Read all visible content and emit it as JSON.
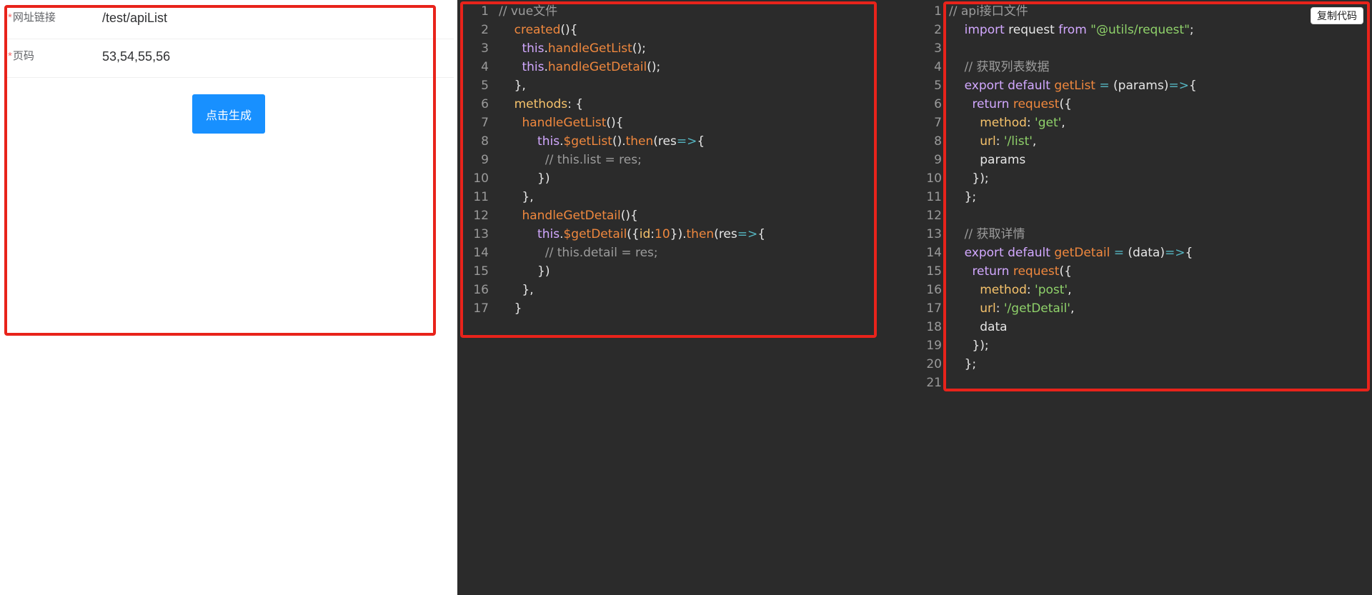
{
  "form": {
    "rows": [
      {
        "label": "网址链接",
        "required_mark": "*",
        "value": "/test/apiList"
      },
      {
        "label": "页码",
        "required_mark": "*",
        "value": "53,54,55,56"
      }
    ],
    "generate_button": "点击生成"
  },
  "code_panels": {
    "vue": {
      "lines": [
        [
          {
            "t": "// vue文件",
            "c": "#9c9c9c"
          }
        ],
        [
          {
            "t": "    "
          },
          {
            "t": "created",
            "c": "#f0883e"
          },
          {
            "t": "(){",
            "c": "#e6e6e6"
          }
        ],
        [
          {
            "t": "      "
          },
          {
            "t": "this",
            "c": "#d2a8ff"
          },
          {
            "t": ".",
            "c": "#e6e6e6"
          },
          {
            "t": "handleGetList",
            "c": "#f0883e"
          },
          {
            "t": "();",
            "c": "#e6e6e6"
          }
        ],
        [
          {
            "t": "      "
          },
          {
            "t": "this",
            "c": "#d2a8ff"
          },
          {
            "t": ".",
            "c": "#e6e6e6"
          },
          {
            "t": "handleGetDetail",
            "c": "#f0883e"
          },
          {
            "t": "();",
            "c": "#e6e6e6"
          }
        ],
        [
          {
            "t": "    },",
            "c": "#e6e6e6"
          }
        ],
        [
          {
            "t": "    "
          },
          {
            "t": "methods",
            "c": "#f5c26b"
          },
          {
            "t": ": {",
            "c": "#e6e6e6"
          }
        ],
        [
          {
            "t": "      "
          },
          {
            "t": "handleGetList",
            "c": "#f0883e"
          },
          {
            "t": "(){",
            "c": "#e6e6e6"
          }
        ],
        [
          {
            "t": "          "
          },
          {
            "t": "this",
            "c": "#d2a8ff"
          },
          {
            "t": ".",
            "c": "#e6e6e6"
          },
          {
            "t": "$getList",
            "c": "#f0883e"
          },
          {
            "t": "().",
            "c": "#e6e6e6"
          },
          {
            "t": "then",
            "c": "#f0883e"
          },
          {
            "t": "(res",
            "c": "#e6e6e6"
          },
          {
            "t": "=>",
            "c": "#56b6c2"
          },
          {
            "t": "{",
            "c": "#e6e6e6"
          }
        ],
        [
          {
            "t": "            "
          },
          {
            "t": "// this.list = res;",
            "c": "#9c9c9c"
          }
        ],
        [
          {
            "t": "          })",
            "c": "#e6e6e6"
          }
        ],
        [
          {
            "t": "      },",
            "c": "#e6e6e6"
          }
        ],
        [
          {
            "t": "      "
          },
          {
            "t": "handleGetDetail",
            "c": "#f0883e"
          },
          {
            "t": "(){",
            "c": "#e6e6e6"
          }
        ],
        [
          {
            "t": "          "
          },
          {
            "t": "this",
            "c": "#d2a8ff"
          },
          {
            "t": ".",
            "c": "#e6e6e6"
          },
          {
            "t": "$getDetail",
            "c": "#f0883e"
          },
          {
            "t": "({",
            "c": "#e6e6e6"
          },
          {
            "t": "id",
            "c": "#f5c26b"
          },
          {
            "t": ":",
            "c": "#e6e6e6"
          },
          {
            "t": "10",
            "c": "#f0883e"
          },
          {
            "t": "}).",
            "c": "#e6e6e6"
          },
          {
            "t": "then",
            "c": "#f0883e"
          },
          {
            "t": "(res",
            "c": "#e6e6e6"
          },
          {
            "t": "=>",
            "c": "#56b6c2"
          },
          {
            "t": "{",
            "c": "#e6e6e6"
          }
        ],
        [
          {
            "t": "            "
          },
          {
            "t": "// this.detail = res;",
            "c": "#9c9c9c"
          }
        ],
        [
          {
            "t": "          })",
            "c": "#e6e6e6"
          }
        ],
        [
          {
            "t": "      },",
            "c": "#e6e6e6"
          }
        ],
        [
          {
            "t": "    }",
            "c": "#e6e6e6"
          }
        ]
      ]
    },
    "api": {
      "copy_button": "复制代码",
      "lines": [
        [
          {
            "t": "// api接口文件",
            "c": "#9c9c9c"
          }
        ],
        [
          {
            "t": "    "
          },
          {
            "t": "import",
            "c": "#d2a8ff"
          },
          {
            "t": " request ",
            "c": "#e6e6e6"
          },
          {
            "t": "from",
            "c": "#d2a8ff"
          },
          {
            "t": " ",
            "c": "#e6e6e6"
          },
          {
            "t": "\"@utils/request\"",
            "c": "#8fd16a"
          },
          {
            "t": ";",
            "c": "#e6e6e6"
          }
        ],
        [
          {
            "t": ""
          }
        ],
        [
          {
            "t": "    "
          },
          {
            "t": "// 获取列表数据",
            "c": "#9c9c9c"
          }
        ],
        [
          {
            "t": "    "
          },
          {
            "t": "export",
            "c": "#d2a8ff"
          },
          {
            "t": " ",
            "c": "#e6e6e6"
          },
          {
            "t": "default",
            "c": "#d2a8ff"
          },
          {
            "t": " ",
            "c": "#e6e6e6"
          },
          {
            "t": "getList",
            "c": "#f0883e"
          },
          {
            "t": " ",
            "c": "#e6e6e6"
          },
          {
            "t": "=",
            "c": "#56b6c2"
          },
          {
            "t": " (params)",
            "c": "#e6e6e6"
          },
          {
            "t": "=>",
            "c": "#56b6c2"
          },
          {
            "t": "{",
            "c": "#e6e6e6"
          }
        ],
        [
          {
            "t": "      "
          },
          {
            "t": "return",
            "c": "#d2a8ff"
          },
          {
            "t": " ",
            "c": "#e6e6e6"
          },
          {
            "t": "request",
            "c": "#f0883e"
          },
          {
            "t": "({",
            "c": "#e6e6e6"
          }
        ],
        [
          {
            "t": "        "
          },
          {
            "t": "method",
            "c": "#f5c26b"
          },
          {
            "t": ": ",
            "c": "#e6e6e6"
          },
          {
            "t": "'get'",
            "c": "#8fd16a"
          },
          {
            "t": ",",
            "c": "#e6e6e6"
          }
        ],
        [
          {
            "t": "        "
          },
          {
            "t": "url",
            "c": "#f5c26b"
          },
          {
            "t": ": ",
            "c": "#e6e6e6"
          },
          {
            "t": "'/list'",
            "c": "#8fd16a"
          },
          {
            "t": ",",
            "c": "#e6e6e6"
          }
        ],
        [
          {
            "t": "        params",
            "c": "#e6e6e6"
          }
        ],
        [
          {
            "t": "      });",
            "c": "#e6e6e6"
          }
        ],
        [
          {
            "t": "    };",
            "c": "#e6e6e6"
          }
        ],
        [
          {
            "t": ""
          }
        ],
        [
          {
            "t": "    "
          },
          {
            "t": "// 获取详情",
            "c": "#9c9c9c"
          }
        ],
        [
          {
            "t": "    "
          },
          {
            "t": "export",
            "c": "#d2a8ff"
          },
          {
            "t": " ",
            "c": "#e6e6e6"
          },
          {
            "t": "default",
            "c": "#d2a8ff"
          },
          {
            "t": " ",
            "c": "#e6e6e6"
          },
          {
            "t": "getDetail",
            "c": "#f0883e"
          },
          {
            "t": " ",
            "c": "#e6e6e6"
          },
          {
            "t": "=",
            "c": "#56b6c2"
          },
          {
            "t": " (data)",
            "c": "#e6e6e6"
          },
          {
            "t": "=>",
            "c": "#56b6c2"
          },
          {
            "t": "{",
            "c": "#e6e6e6"
          }
        ],
        [
          {
            "t": "      "
          },
          {
            "t": "return",
            "c": "#d2a8ff"
          },
          {
            "t": " ",
            "c": "#e6e6e6"
          },
          {
            "t": "request",
            "c": "#f0883e"
          },
          {
            "t": "({",
            "c": "#e6e6e6"
          }
        ],
        [
          {
            "t": "        "
          },
          {
            "t": "method",
            "c": "#f5c26b"
          },
          {
            "t": ": ",
            "c": "#e6e6e6"
          },
          {
            "t": "'post'",
            "c": "#8fd16a"
          },
          {
            "t": ",",
            "c": "#e6e6e6"
          }
        ],
        [
          {
            "t": "        "
          },
          {
            "t": "url",
            "c": "#f5c26b"
          },
          {
            "t": ": ",
            "c": "#e6e6e6"
          },
          {
            "t": "'/getDetail'",
            "c": "#8fd16a"
          },
          {
            "t": ",",
            "c": "#e6e6e6"
          }
        ],
        [
          {
            "t": "        data",
            "c": "#e6e6e6"
          }
        ],
        [
          {
            "t": "      });",
            "c": "#e6e6e6"
          }
        ],
        [
          {
            "t": "    };",
            "c": "#e6e6e6"
          }
        ],
        [
          {
            "t": ""
          }
        ]
      ]
    }
  },
  "colors": {
    "highlight_border": "#e8231b",
    "primary_button": "#1890ff",
    "code_background": "#2b2b2b"
  }
}
